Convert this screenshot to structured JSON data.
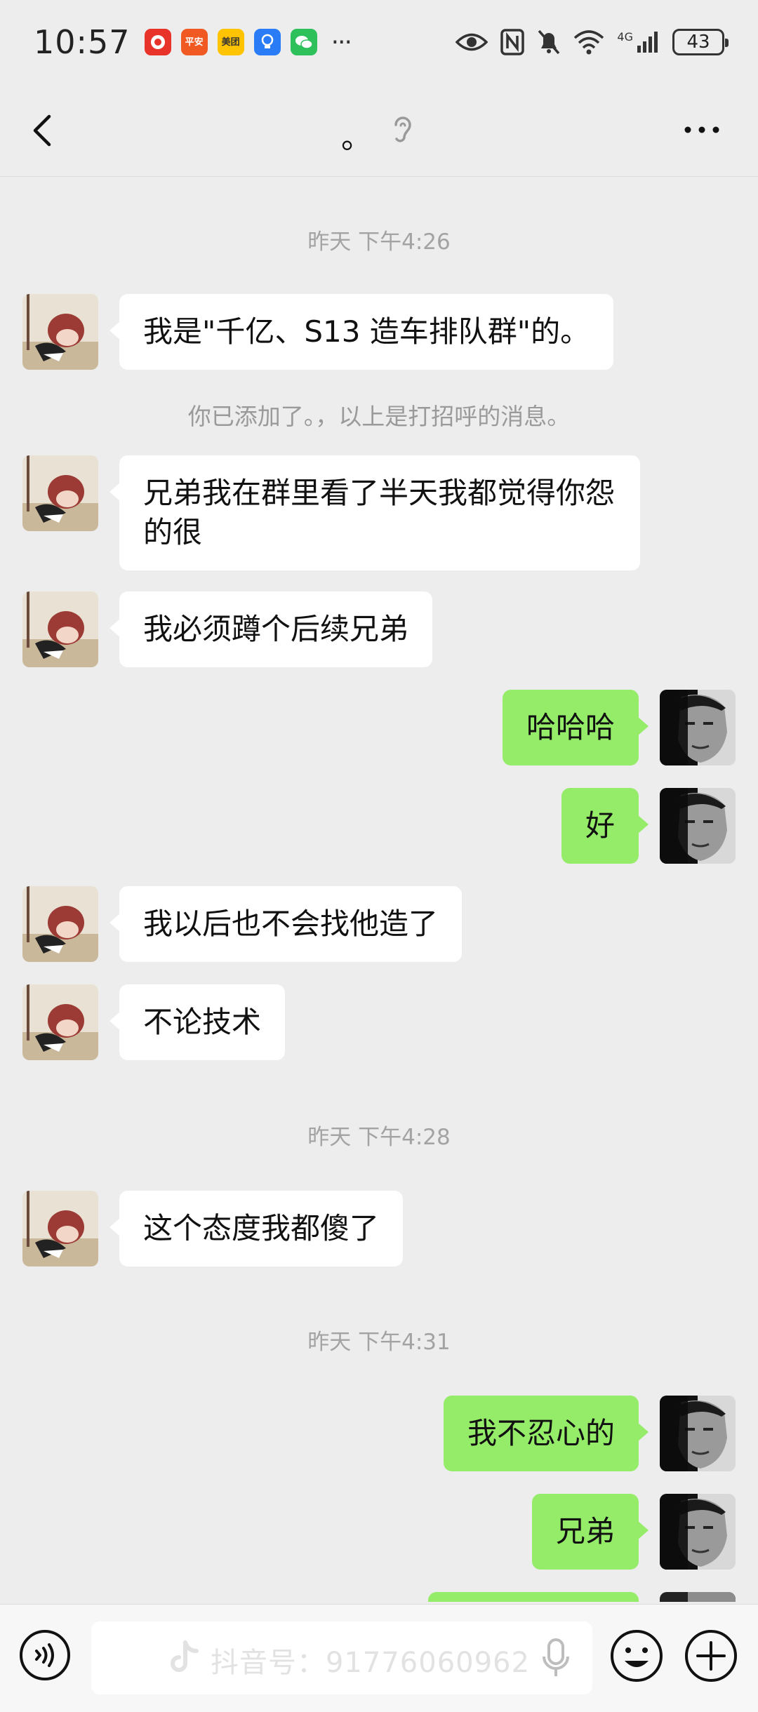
{
  "status_bar": {
    "time": "10:57",
    "battery_level": "43",
    "signal_label": "4G",
    "apps": [
      {
        "name": "pdd-app-icon",
        "color": "#e8332a",
        "label": ""
      },
      {
        "name": "pingan-bank-app-icon",
        "color": "#f05a22",
        "label": "平安"
      },
      {
        "name": "meituan-app-icon",
        "color": "#ffc300",
        "label": "美团"
      },
      {
        "name": "bulb-app-icon",
        "color": "#2a7cf6",
        "label": ""
      },
      {
        "name": "wechat-app-icon",
        "color": "#2ec05b",
        "label": ""
      }
    ],
    "more_indicator": "···"
  },
  "nav": {
    "title": "。"
  },
  "chat": {
    "time_1": "昨天 下午4:26",
    "msg_1": "我是\"千亿、S13 造车排队群\"的。",
    "system_1": "你已添加了。，以上是打招呼的消息。",
    "msg_2": "兄弟我在群里看了半天我都觉得你怨的很",
    "msg_3": "我必须蹲个后续兄弟",
    "msg_4": "哈哈哈",
    "msg_5": "好",
    "msg_6": "我以后也不会找他造了",
    "msg_7": "不论技术",
    "time_2": "昨天 下午4:28",
    "msg_8": "这个态度我都傻了",
    "time_3": "昨天 下午4:31",
    "msg_9": "我不忍心的",
    "msg_10": "兄弟"
  },
  "input_bar": {
    "watermark": "抖音号：917760609​62"
  },
  "colors": {
    "background": "#ededed",
    "incoming_bubble": "#ffffff",
    "outgoing_bubble": "#95ec69",
    "timestamp_text": "#a3a3a3"
  }
}
